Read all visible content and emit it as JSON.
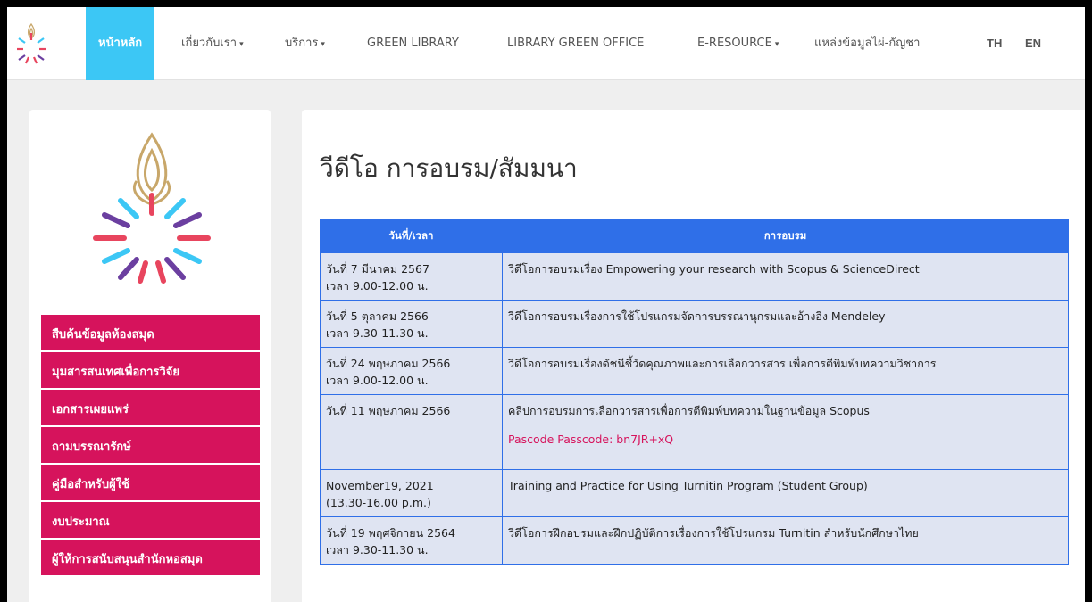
{
  "nav": {
    "items": [
      {
        "label": "หน้าหลัก",
        "active": true
      },
      {
        "label": "เกี่ยวกับเรา",
        "caret": true
      },
      {
        "label": "บริการ",
        "caret": true
      },
      {
        "label": "GREEN LIBRARY"
      },
      {
        "label": "LIBRARY GREEN OFFICE"
      },
      {
        "label": "E-RESOURCE",
        "caret": true
      },
      {
        "label": "แหล่งข้อมูลไผ่-กัญชา"
      },
      {
        "label": "TH"
      },
      {
        "label": "EN"
      }
    ],
    "active_color": "#3cc7f5"
  },
  "sidebar": {
    "menu": [
      "สืบค้นข้อมูลห้องสมุด",
      "มุมสารสนเทศเพื่อการวิจัย",
      "เอกสารเผยแพร่",
      "ถามบรรณารักษ์",
      "คู่มือสำหรับผู้ใช้",
      "งบประมาณ",
      "ผู้ให้การสนับสนุนสำนักหอสมุด"
    ],
    "menu_color": "#d6135c"
  },
  "main": {
    "title": "วีดีโอ การอบรม/สัมมนา",
    "table": {
      "headers": [
        "วันที่/เวลา",
        "การอบรม"
      ],
      "rows": [
        {
          "date": "วันที่ 7 มีนาคม 2567",
          "time": "เวลา 9.00-12.00 น.",
          "training": "วีดีโอการอบรมเรื่อง Empowering your research with Scopus & ScienceDirect",
          "note": ""
        },
        {
          "date": "วันที่ 5 ตุลาคม 2566",
          "time": "เวลา 9.30-11.30 น.",
          "training": "วีดีโอการอบรมเรื่องการใช้โปรแกรมจัดการบรรณานุกรมและอ้างอิง Mendeley",
          "note": ""
        },
        {
          "date": "วันที่ 24 พฤษภาคม 2566",
          "time": "เวลา 9.00-12.00 น.",
          "training": "วีดีโอการอบรมเรื่องดัชนีชี้วัดคุณภาพและการเลือกวารสาร เพื่อการตีพิมพ์บทความวิชาการ",
          "note": ""
        },
        {
          "date": "วันที่ 11 พฤษภาคม 2566",
          "time": "",
          "training": "คลิปการอบรมการเลือกวารสารเพื่อการตีพิมพ์บทความในฐานข้อมูล Scopus",
          "note": "Pascode Passcode: bn7JR+xQ"
        },
        {
          "date": "November19, 2021",
          "time": "(13.30-16.00 p.m.)",
          "training": "Training and Practice for Using Turnitin Program (Student Group)",
          "note": ""
        },
        {
          "date": "วันที่ 19 พฤศจิกายน 2564",
          "time": "เวลา 9.30-11.30 น.",
          "training": "วีดีโอการฝึกอบรมและฝึกปฏิบัติการเรื่องการใช้โปรแกรม Turnitin สำหรับนักศึกษาไทย",
          "note": ""
        }
      ],
      "header_color": "#2f6fe8",
      "row_color": "#dfe4f2"
    }
  }
}
